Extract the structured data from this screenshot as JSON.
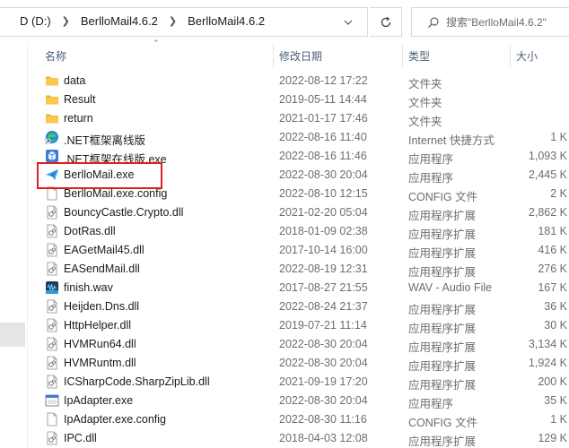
{
  "address": {
    "crumbs": [
      "D (D:)",
      "BerlloMail4.6.2",
      "BerlloMail4.6.2"
    ]
  },
  "search": {
    "placeholder": "搜索\"BerlloMail4.6.2\""
  },
  "columns": {
    "name": "名称",
    "date": "修改日期",
    "type": "类型",
    "size": "大小"
  },
  "files": [
    {
      "name": "data",
      "date": "2022-08-12 17:22",
      "type": "文件夹",
      "size": "",
      "icon": "folder-icon"
    },
    {
      "name": "Result",
      "date": "2019-05-11 14:44",
      "type": "文件夹",
      "size": "",
      "icon": "folder-icon"
    },
    {
      "name": "return",
      "date": "2021-01-17 17:46",
      "type": "文件夹",
      "size": "",
      "icon": "folder-icon"
    },
    {
      "name": ".NET框架离线版",
      "date": "2022-08-16 11:40",
      "type": "Internet 快捷方式",
      "size": "1 K",
      "icon": "edge-shortcut-icon"
    },
    {
      "name": ".NET框架在线版.exe",
      "date": "2022-08-16 11:46",
      "type": "应用程序",
      "size": "1,093 K",
      "icon": "installer-icon"
    },
    {
      "name": "BerlloMail.exe",
      "date": "2022-08-30 20:04",
      "type": "应用程序",
      "size": "2,445 K",
      "icon": "paper-plane-icon"
    },
    {
      "name": "BerlloMail.exe.config",
      "date": "2022-08-10 12:15",
      "type": "CONFIG 文件",
      "size": "2 K",
      "icon": "file-icon"
    },
    {
      "name": "BouncyCastle.Crypto.dll",
      "date": "2021-02-20 05:04",
      "type": "应用程序扩展",
      "size": "2,862 K",
      "icon": "dll-icon"
    },
    {
      "name": "DotRas.dll",
      "date": "2018-01-09 02:38",
      "type": "应用程序扩展",
      "size": "181 K",
      "icon": "dll-icon"
    },
    {
      "name": "EAGetMail45.dll",
      "date": "2017-10-14 16:00",
      "type": "应用程序扩展",
      "size": "416 K",
      "icon": "dll-icon"
    },
    {
      "name": "EASendMail.dll",
      "date": "2022-08-19 12:31",
      "type": "应用程序扩展",
      "size": "276 K",
      "icon": "dll-icon"
    },
    {
      "name": "finish.wav",
      "date": "2017-08-27 21:55",
      "type": "WAV - Audio File",
      "size": "167 K",
      "icon": "wav-icon"
    },
    {
      "name": "Heijden.Dns.dll",
      "date": "2022-08-24 21:37",
      "type": "应用程序扩展",
      "size": "36 K",
      "icon": "dll-icon"
    },
    {
      "name": "HttpHelper.dll",
      "date": "2019-07-21 11:14",
      "type": "应用程序扩展",
      "size": "30 K",
      "icon": "dll-icon"
    },
    {
      "name": "HVMRun64.dll",
      "date": "2022-08-30 20:04",
      "type": "应用程序扩展",
      "size": "3,134 K",
      "icon": "dll-icon"
    },
    {
      "name": "HVMRuntm.dll",
      "date": "2022-08-30 20:04",
      "type": "应用程序扩展",
      "size": "1,924 K",
      "icon": "dll-icon"
    },
    {
      "name": "ICSharpCode.SharpZipLib.dll",
      "date": "2021-09-19 17:20",
      "type": "应用程序扩展",
      "size": "200 K",
      "icon": "dll-icon"
    },
    {
      "name": "IpAdapter.exe",
      "date": "2022-08-30 20:04",
      "type": "应用程序",
      "size": "35 K",
      "icon": "exe-icon"
    },
    {
      "name": "IpAdapter.exe.config",
      "date": "2022-08-30 11:16",
      "type": "CONFIG 文件",
      "size": "1 K",
      "icon": "file-icon"
    },
    {
      "name": "IPC.dll",
      "date": "2018-04-03 12:08",
      "type": "应用程序扩展",
      "size": "129 K",
      "icon": "dll-icon"
    }
  ],
  "colors": {
    "folder": "#f8c94a",
    "highlight": "#e02020",
    "header_text": "#4c607a",
    "meta_text": "#6d6d6d"
  }
}
